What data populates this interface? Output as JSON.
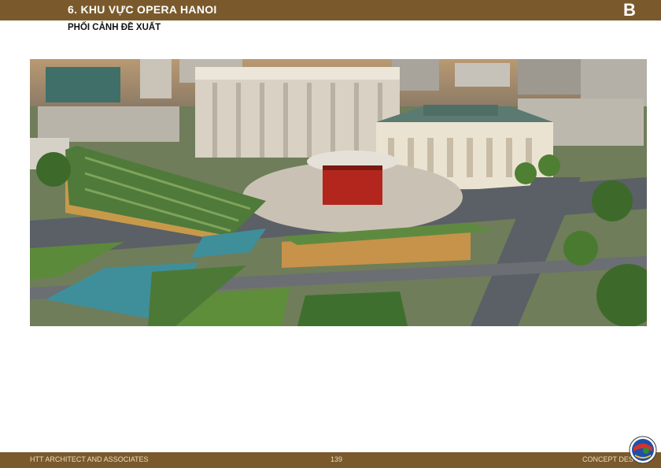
{
  "header": {
    "title": "6. KHU VỰC OPERA HANOI",
    "mark": "B"
  },
  "subtitle": "PHỐI CẢNH ĐỀ XUẤT",
  "footer": {
    "left": "HTT ARCHITECT AND ASSOCIATES",
    "page": "139",
    "right": "CONCEPT DES"
  },
  "colors": {
    "brand": "#7a5a2c",
    "footer_text": "#e9dcc4"
  },
  "icons": {
    "logo": "globe-seal-icon"
  }
}
